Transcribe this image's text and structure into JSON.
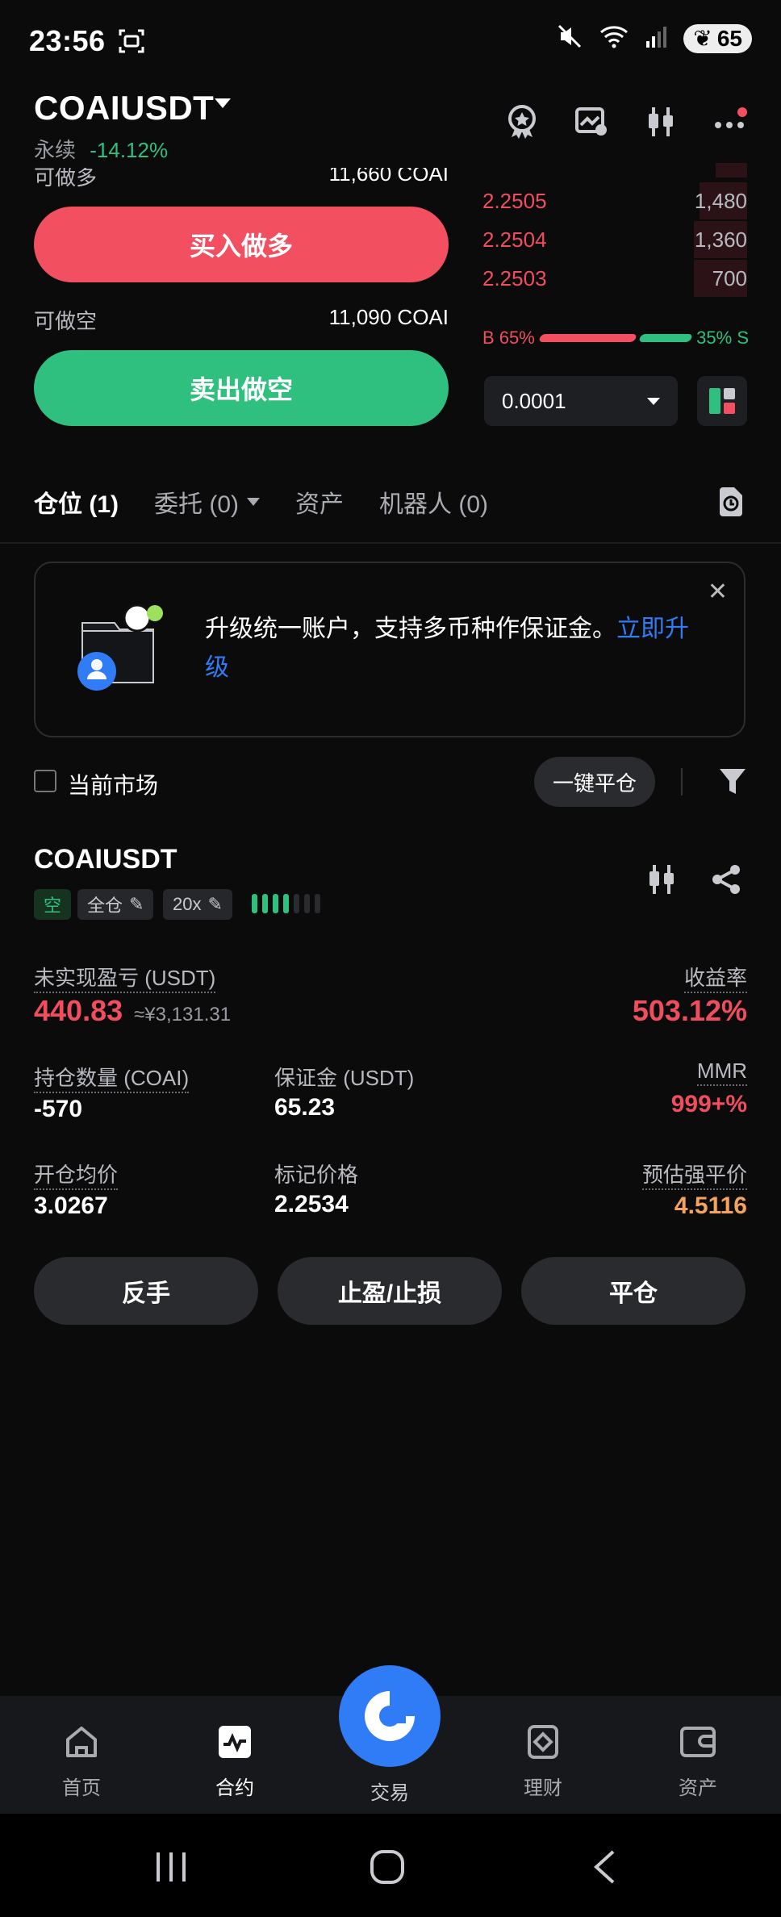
{
  "status_bar": {
    "time": "23:56",
    "battery": "65"
  },
  "header": {
    "pair": "COAIUSDT",
    "contract_type": "永续",
    "change": "-14.12%"
  },
  "trade_panel": {
    "long_label": "可做多",
    "long_value": "11,660 COAI",
    "buy_button": "买入做多",
    "short_label": "可做空",
    "short_value": "11,090 COAI",
    "sell_button": "卖出做空"
  },
  "order_book": {
    "asks": [
      {
        "price": "2.2505",
        "qty": "1,480",
        "depth": 0.18
      },
      {
        "price": "2.2504",
        "qty": "1,360",
        "depth": 0.2
      },
      {
        "price": "2.2503",
        "qty": "700",
        "depth": 0.2
      }
    ],
    "buy_ratio_label": "B 65%",
    "sell_ratio_label": "35% S",
    "buy_ratio": 0.65,
    "precision": "0.0001"
  },
  "tabs": [
    {
      "label": "仓位 (1)"
    },
    {
      "label": "委托 (0)"
    },
    {
      "label": "资产"
    },
    {
      "label": "机器人 (0)"
    }
  ],
  "banner": {
    "text": "升级统一账户，支持多币种作保证金。",
    "link": "立即升级"
  },
  "filter": {
    "current_market": "当前市场",
    "close_all": "一键平仓"
  },
  "position": {
    "symbol": "COAIUSDT",
    "side": "空",
    "margin_mode": "全仓",
    "leverage": "20x",
    "unrealized_label": "未实现盈亏 (USDT)",
    "unrealized_value": "440.83",
    "unrealized_cny": "≈¥3,131.31",
    "roe_label": "收益率",
    "roe_value": "503.12%",
    "size_label": "持仓数量 (COAI)",
    "size_value": "-570",
    "margin_label": "保证金 (USDT)",
    "margin_value": "65.23",
    "mmr_label": "MMR",
    "mmr_value": "999+%",
    "entry_label": "开仓均价",
    "entry_value": "3.0267",
    "mark_label": "标记价格",
    "mark_value": "2.2534",
    "liq_label": "预估强平价",
    "liq_value": "4.5116",
    "btn_reverse": "反手",
    "btn_tpsl": "止盈/止损",
    "btn_close": "平仓"
  },
  "bottom_nav": [
    {
      "label": "首页",
      "icon": "home-icon"
    },
    {
      "label": "合约",
      "icon": "futures-icon"
    },
    {
      "label": "交易",
      "icon": "trade-logo-icon"
    },
    {
      "label": "理财",
      "icon": "earn-icon"
    },
    {
      "label": "资产",
      "icon": "wallet-icon"
    }
  ],
  "colors": {
    "red": "#f04d5f",
    "green": "#2fc07f",
    "blue": "#2f7cf6",
    "orange": "#f5a25d"
  }
}
